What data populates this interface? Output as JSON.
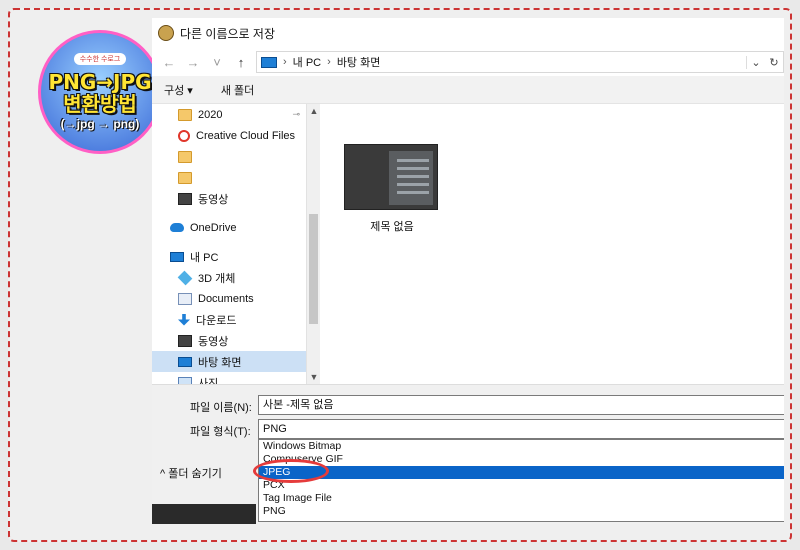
{
  "badge": {
    "small_text": "수수한 수로그",
    "line1": "PNG→JPG",
    "line2": "변환방법",
    "line3": "(→jpg → png)"
  },
  "dialog": {
    "title": "다른 이름으로 저장",
    "nav": {
      "back_glyph": "←",
      "forward_glyph": "→",
      "down_glyph": "˅",
      "up_glyph": "↑"
    },
    "address": {
      "segments": [
        "내 PC",
        "바탕 화면"
      ],
      "separator": "›",
      "dropdown_glyph": "⌄",
      "refresh_glyph": "↻"
    },
    "toolbar": {
      "organize": "구성",
      "new_folder": "새 폴더"
    },
    "sidebar": {
      "items": [
        {
          "label": "2020",
          "icon": "folder-icon",
          "pinned": true
        },
        {
          "label": "Creative Cloud Files",
          "icon": "creative-cloud-icon"
        },
        {
          "label": "",
          "icon": "folder-icon"
        },
        {
          "label": "",
          "icon": "folder-icon"
        },
        {
          "label": "동영상",
          "icon": "film-icon"
        },
        {
          "label": "OneDrive",
          "icon": "cloud-icon"
        },
        {
          "label": "내 PC",
          "icon": "pc-icon"
        },
        {
          "label": "3D 개체",
          "icon": "cube-icon"
        },
        {
          "label": "Documents",
          "icon": "document-icon"
        },
        {
          "label": "다운로드",
          "icon": "download-icon"
        },
        {
          "label": "동영상",
          "icon": "film-icon"
        },
        {
          "label": "바탕 화면",
          "icon": "desktop-icon",
          "selected": true
        },
        {
          "label": "사진",
          "icon": "pictures-icon"
        }
      ],
      "pin_glyph": "📌"
    },
    "files": [
      {
        "name": "제목 없음"
      }
    ],
    "fields": {
      "filename_label": "파일 이름(N):",
      "filename_value": "사본 -제목 없음",
      "filetype_label": "파일 형식(T):",
      "filetype_value": "PNG",
      "filetype_options": [
        "Windows Bitmap",
        "Compuserve GIF",
        "JPEG",
        "PCX",
        "Tag Image File",
        "PNG"
      ],
      "selected_option": "JPEG",
      "hide_folders": "폴더 숨기기"
    }
  },
  "colors": {
    "selection": "#0a64c8",
    "highlight_circle": "#e53b3b",
    "badge_border": "#ff5fc5"
  }
}
